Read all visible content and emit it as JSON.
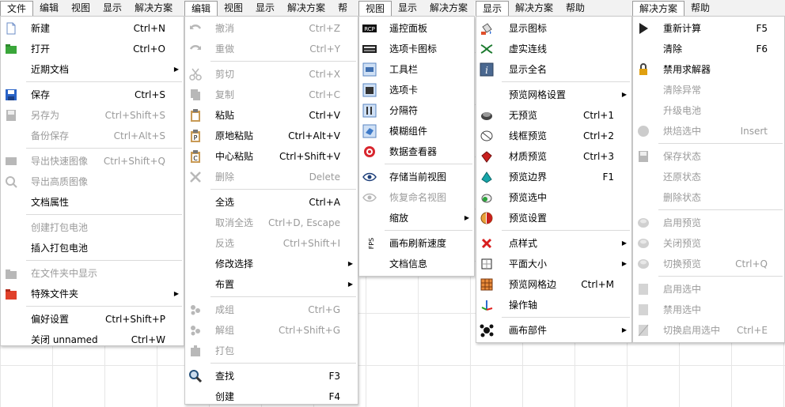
{
  "panels": [
    {
      "id": "file",
      "menubar": [
        "文件",
        "编辑",
        "视图",
        "显示",
        "解决方案"
      ],
      "active": 0,
      "items": [
        {
          "label": "新建",
          "shortcut": "Ctrl+N",
          "icon": "new-file-icon"
        },
        {
          "label": "打开",
          "shortcut": "Ctrl+O",
          "icon": "open-folder-icon"
        },
        {
          "label": "近期文档",
          "submenu": true
        },
        {
          "sep": true
        },
        {
          "label": "保存",
          "shortcut": "Ctrl+S",
          "icon": "save-icon"
        },
        {
          "label": "另存为",
          "shortcut": "Ctrl+Shift+S",
          "disabled": true,
          "icon": "save-as-icon"
        },
        {
          "label": "备份保存",
          "shortcut": "Ctrl+Alt+S",
          "disabled": true
        },
        {
          "sep": true
        },
        {
          "label": "导出快速图像",
          "shortcut": "Ctrl+Shift+Q",
          "disabled": true,
          "icon": "export-quick-image-icon"
        },
        {
          "label": "导出高质图像",
          "disabled": true,
          "icon": "export-hq-image-icon"
        },
        {
          "label": "文档属性"
        },
        {
          "sep": true
        },
        {
          "label": "创建打包电池",
          "disabled": true
        },
        {
          "label": "插入打包电池"
        },
        {
          "sep": true
        },
        {
          "label": "在文件夹中显示",
          "disabled": true,
          "icon": "show-in-folder-icon"
        },
        {
          "label": "特殊文件夹",
          "submenu": true,
          "icon": "special-folder-icon"
        },
        {
          "sep": true
        },
        {
          "label": "偏好设置",
          "shortcut": "Ctrl+Shift+P"
        },
        {
          "label": "关闭 unnamed",
          "shortcut": "Ctrl+W"
        }
      ]
    },
    {
      "id": "edit",
      "menubar": [
        "编辑",
        "视图",
        "显示",
        "解决方案",
        "帮"
      ],
      "active": 0,
      "items": [
        {
          "label": "撤消",
          "shortcut": "Ctrl+Z",
          "disabled": true,
          "icon": "undo-icon"
        },
        {
          "label": "重做",
          "shortcut": "Ctrl+Y",
          "disabled": true,
          "icon": "redo-icon"
        },
        {
          "sep": true
        },
        {
          "label": "剪切",
          "shortcut": "Ctrl+X",
          "disabled": true,
          "icon": "scissors-icon"
        },
        {
          "label": "复制",
          "shortcut": "Ctrl+C",
          "disabled": true,
          "icon": "copy-icon"
        },
        {
          "label": "粘贴",
          "shortcut": "Ctrl+V",
          "icon": "paste-icon"
        },
        {
          "label": "原地粘贴",
          "shortcut": "Ctrl+Alt+V",
          "icon": "paste-in-place-icon"
        },
        {
          "label": "中心粘贴",
          "shortcut": "Ctrl+Shift+V",
          "icon": "paste-center-icon"
        },
        {
          "label": "删除",
          "shortcut": "Delete",
          "disabled": true,
          "icon": "delete-icon"
        },
        {
          "sep": true
        },
        {
          "label": "全选",
          "shortcut": "Ctrl+A"
        },
        {
          "label": "取消全选",
          "shortcut": "Ctrl+D, Escape",
          "disabled": true
        },
        {
          "label": "反选",
          "shortcut": "Ctrl+Shift+I",
          "disabled": true
        },
        {
          "label": "修改选择",
          "submenu": true
        },
        {
          "label": "布置",
          "submenu": true
        },
        {
          "sep": true
        },
        {
          "label": "成组",
          "shortcut": "Ctrl+G",
          "disabled": true,
          "icon": "group-icon"
        },
        {
          "label": "解组",
          "shortcut": "Ctrl+Shift+G",
          "disabled": true,
          "icon": "ungroup-icon"
        },
        {
          "label": "打包",
          "disabled": true,
          "icon": "package-icon"
        },
        {
          "sep": true
        },
        {
          "label": "查找",
          "shortcut": "F3",
          "icon": "search-icon"
        },
        {
          "label": "创建",
          "shortcut": "F4"
        }
      ]
    },
    {
      "id": "view",
      "menubar": [
        "视图",
        "显示",
        "解决方案"
      ],
      "active": 0,
      "items": [
        {
          "label": "遥控面板",
          "icon": "remote-control-panel-icon"
        },
        {
          "label": "选项卡图标",
          "icon": "tab-icons-icon"
        },
        {
          "label": "工具栏",
          "icon": "toolbar-icon"
        },
        {
          "label": "选项卡",
          "icon": "tabs-icon"
        },
        {
          "label": "分隔符",
          "icon": "separator-icon"
        },
        {
          "label": "模糊组件",
          "icon": "fuzzy-component-icon"
        },
        {
          "label": "数据查看器",
          "icon": "data-viewer-icon"
        },
        {
          "sep": true
        },
        {
          "label": "存储当前视图",
          "icon": "eye-icon"
        },
        {
          "label": "恢复命名视图",
          "disabled": true,
          "icon": "eye-icon"
        },
        {
          "label": "缩放",
          "submenu": true
        },
        {
          "sep": true
        },
        {
          "label": "画布刷新速度",
          "icon": "fps-icon"
        },
        {
          "label": "文档信息"
        }
      ]
    },
    {
      "id": "display",
      "menubar": [
        "显示",
        "解决方案",
        "帮助"
      ],
      "active": 0,
      "items": [
        {
          "label": "显示图标",
          "icon": "paint-bucket-icon"
        },
        {
          "label": "虚实连线",
          "icon": "wire-display-icon"
        },
        {
          "label": "显示全名",
          "icon": "info-icon"
        },
        {
          "sep": true
        },
        {
          "label": "预览网格设置",
          "submenu": true
        },
        {
          "label": "无预览",
          "shortcut": "Ctrl+1",
          "icon": "no-preview-icon"
        },
        {
          "label": "线框预览",
          "shortcut": "Ctrl+2",
          "icon": "wireframe-preview-icon"
        },
        {
          "label": "材质预览",
          "shortcut": "Ctrl+3",
          "icon": "shaded-preview-icon"
        },
        {
          "label": "预览边界",
          "shortcut": "F1",
          "icon": "preview-bounds-icon"
        },
        {
          "label": "预览选中",
          "icon": "preview-selected-icon"
        },
        {
          "label": "预览设置",
          "icon": "preview-settings-icon"
        },
        {
          "sep": true
        },
        {
          "label": "点样式",
          "submenu": true,
          "icon": "point-style-icon"
        },
        {
          "label": "平面大小",
          "submenu": true,
          "icon": "plane-size-icon"
        },
        {
          "label": "预览网格边",
          "shortcut": "Ctrl+M",
          "icon": "mesh-edges-icon"
        },
        {
          "label": "操作轴",
          "icon": "gizmo-icon"
        },
        {
          "sep": true
        },
        {
          "label": "画布部件",
          "submenu": true,
          "icon": "canvas-widgets-icon"
        }
      ]
    },
    {
      "id": "solution",
      "menubar": [
        "解决方案",
        "帮助"
      ],
      "active": 0,
      "items": [
        {
          "label": "重新计算",
          "shortcut": "F5",
          "icon": "play-icon"
        },
        {
          "label": "清除",
          "shortcut": "F6"
        },
        {
          "label": "禁用求解器",
          "icon": "lock-icon"
        },
        {
          "label": "清除异常",
          "disabled": true
        },
        {
          "label": "升级电池",
          "disabled": true
        },
        {
          "label": "烘焙选中",
          "shortcut": "Insert",
          "disabled": true,
          "icon": "bake-icon"
        },
        {
          "sep": true
        },
        {
          "label": "保存状态",
          "disabled": true,
          "icon": "save-state-icon"
        },
        {
          "label": "还原状态",
          "disabled": true
        },
        {
          "label": "删除状态",
          "disabled": true
        },
        {
          "sep": true
        },
        {
          "label": "启用预览",
          "disabled": true,
          "icon": "enable-preview-icon"
        },
        {
          "label": "关闭预览",
          "disabled": true,
          "icon": "disable-preview-icon"
        },
        {
          "label": "切换预览",
          "shortcut": "Ctrl+Q",
          "disabled": true,
          "icon": "toggle-preview-icon"
        },
        {
          "sep": true
        },
        {
          "label": "启用选中",
          "disabled": true,
          "icon": "enable-selected-icon"
        },
        {
          "label": "禁用选中",
          "disabled": true,
          "icon": "disable-selected-icon"
        },
        {
          "label": "切换启用选中",
          "shortcut": "Ctrl+E",
          "disabled": true,
          "icon": "toggle-enable-icon"
        }
      ]
    }
  ]
}
